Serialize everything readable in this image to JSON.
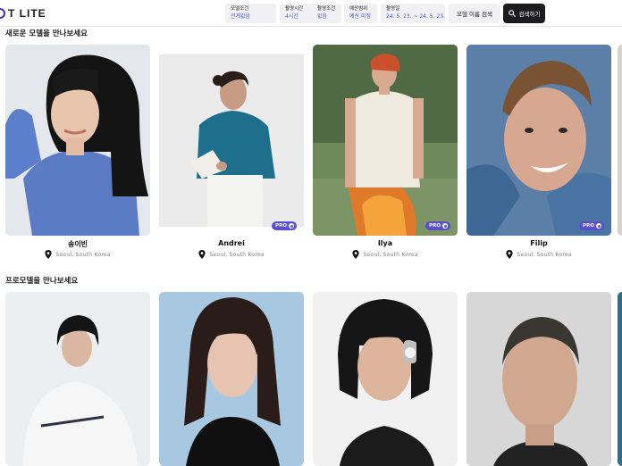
{
  "header": {
    "logo_text": "T LITE",
    "filters": [
      {
        "label": "모델조건",
        "value": "관계없음"
      },
      {
        "label": "촬영시간",
        "value": "4시간"
      },
      {
        "label": "촬영조건",
        "value": "없음"
      },
      {
        "label": "예산범위",
        "value": "예산 미정"
      },
      {
        "label": "촬영일",
        "value": "24. 5. 23. ~ 24. 5. 23."
      }
    ],
    "name_search_label": "모델 이름 검색",
    "search_button_label": "검색하기"
  },
  "sections": [
    {
      "title": "새로운 모델을 만나보세요",
      "models": [
        {
          "name": "송이빈",
          "location": "Seoul, South Korea",
          "pro": false
        },
        {
          "name": "Andrei",
          "location": "Seoul, South Korea",
          "pro": true
        },
        {
          "name": "Ilya",
          "location": "Seoul, South Korea",
          "pro": true
        },
        {
          "name": "Filip",
          "location": "Seoul, South Korea",
          "pro": true
        }
      ]
    },
    {
      "title": "프로모델을 만나보세요"
    }
  ],
  "pro_badge_label": "PRO",
  "colors": {
    "accent": "#4a57e6",
    "pro_badge": "#5a4fcf",
    "search_button": "#1c1c1e"
  }
}
